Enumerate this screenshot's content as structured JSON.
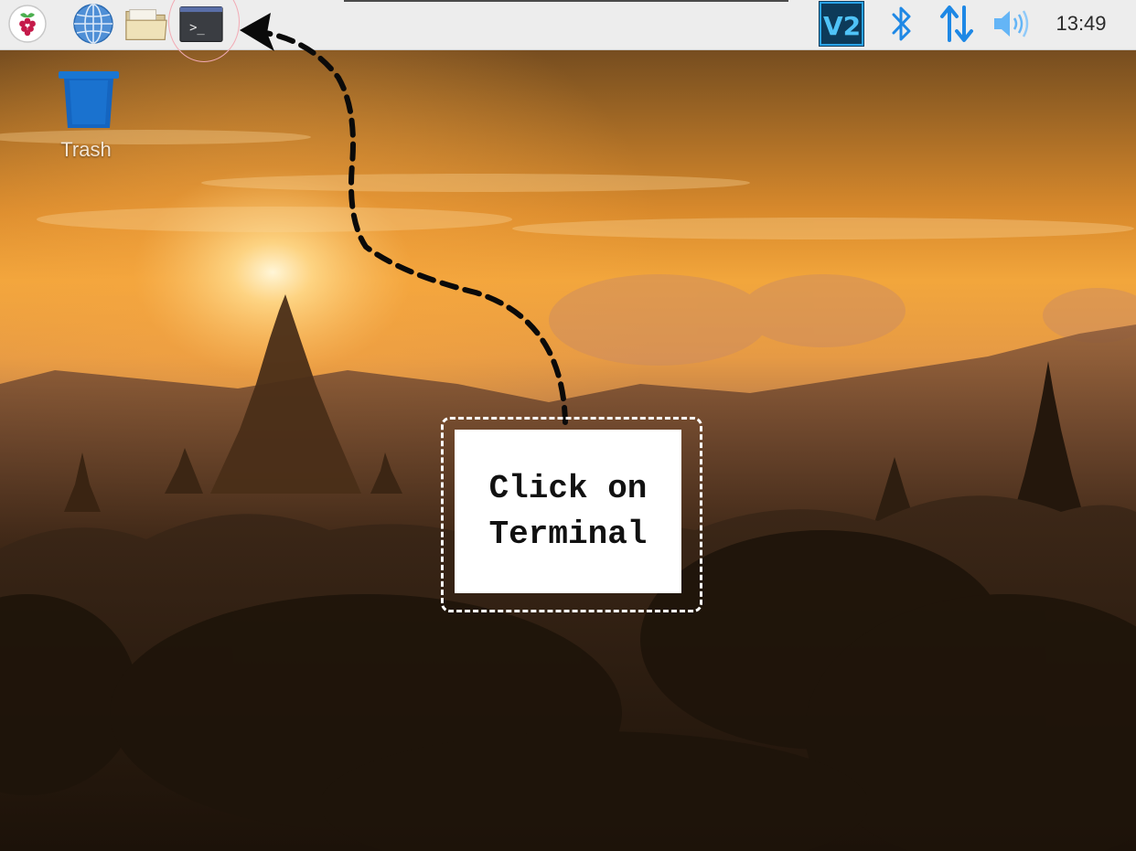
{
  "taskbar": {
    "launchers": [
      {
        "name": "raspberry-menu",
        "icon": "raspberry-pi-icon"
      },
      {
        "name": "web-browser",
        "icon": "globe-icon"
      },
      {
        "name": "file-manager",
        "icon": "folder-icon"
      },
      {
        "name": "terminal",
        "icon": "terminal-icon",
        "glyph": ">_"
      }
    ],
    "tray": {
      "vnc_label": "V2",
      "icons": [
        "vnc-icon",
        "bluetooth-icon",
        "network-icon",
        "volume-icon"
      ],
      "clock": "13:49"
    }
  },
  "desktop": {
    "icons": [
      {
        "label": "Trash",
        "icon": "trash-icon"
      }
    ]
  },
  "annotation": {
    "lines": [
      "Click on",
      "Terminal"
    ]
  },
  "colors": {
    "taskbar_bg": "#ededed",
    "tray_accent": "#1e88e5",
    "vnc_bg": "#0d3a59",
    "trash_blue": "#1565c0",
    "sky_glow": "#f3a23a"
  }
}
